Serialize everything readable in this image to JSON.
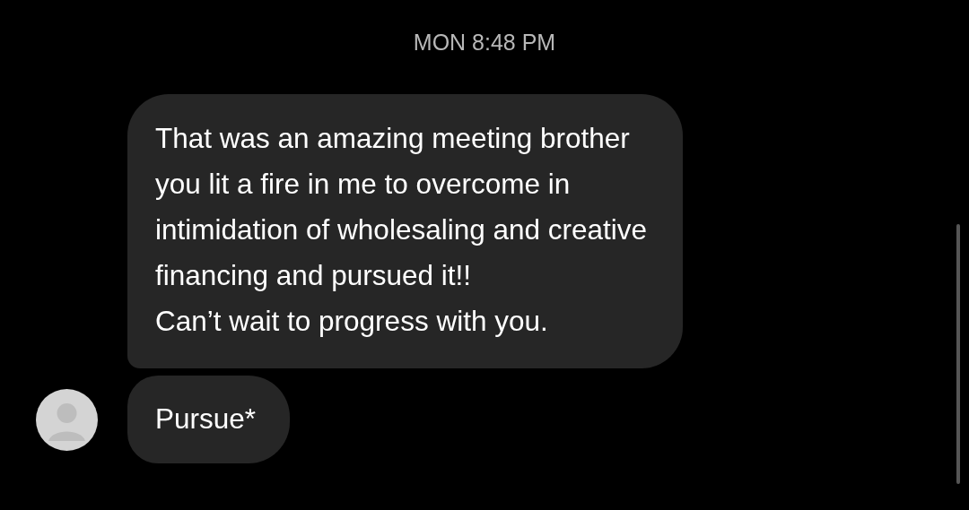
{
  "timestamp": "MON 8:48 PM",
  "messages": [
    {
      "text": "That was an amazing meeting brother\nyou lit a fire in me to overcome in\nintimidation of wholesaling and creative\nfinancing and pursued it!!\nCan’t wait to progress with you.",
      "avatar": false
    },
    {
      "text": "Pursue*",
      "avatar": true
    }
  ]
}
